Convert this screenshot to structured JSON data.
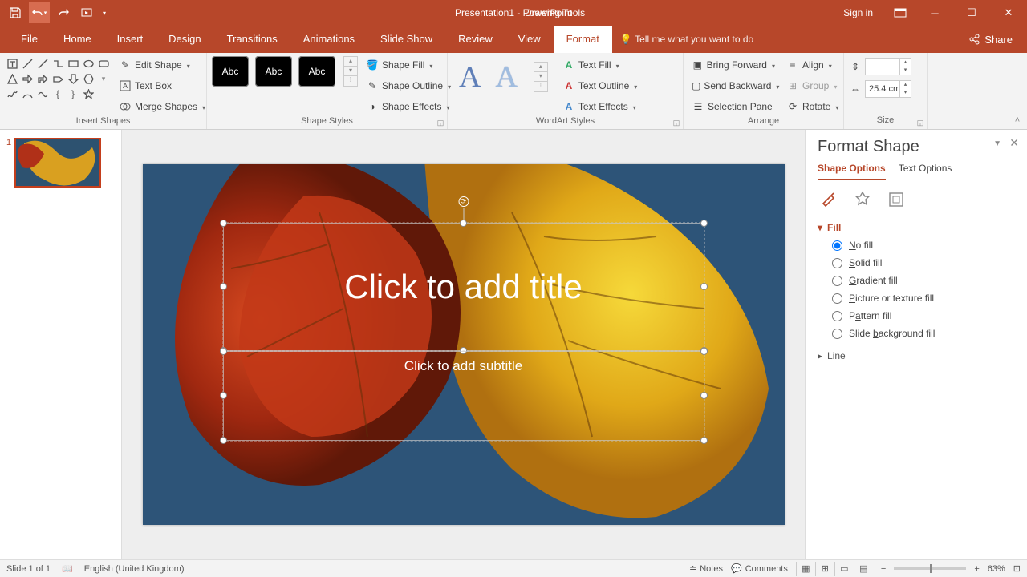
{
  "title_bar": {
    "title": "Presentation1 - PowerPoint",
    "context_tab": "Drawing Tools",
    "sign_in": "Sign in"
  },
  "tabs": {
    "file": "File",
    "home": "Home",
    "insert": "Insert",
    "design": "Design",
    "transitions": "Transitions",
    "animations": "Animations",
    "slideshow": "Slide Show",
    "review": "Review",
    "view": "View",
    "format": "Format",
    "tellme": "Tell me what you want to do",
    "share": "Share"
  },
  "ribbon": {
    "insert_shapes": {
      "label": "Insert Shapes",
      "edit_shape": "Edit Shape",
      "text_box": "Text Box",
      "merge_shapes": "Merge Shapes"
    },
    "shape_styles": {
      "label": "Shape Styles",
      "abc": "Abc",
      "shape_fill": "Shape Fill",
      "shape_outline": "Shape Outline",
      "shape_effects": "Shape Effects"
    },
    "wordart_styles": {
      "label": "WordArt Styles",
      "text_fill": "Text Fill",
      "text_outline": "Text Outline",
      "text_effects": "Text Effects"
    },
    "arrange": {
      "label": "Arrange",
      "bring_forward": "Bring Forward",
      "send_backward": "Send Backward",
      "selection_pane": "Selection Pane",
      "align": "Align",
      "group": "Group",
      "rotate": "Rotate"
    },
    "size": {
      "label": "Size",
      "height": "",
      "width": "25.4 cm"
    }
  },
  "thumb": {
    "num": "1"
  },
  "slide": {
    "title_placeholder": "Click to add title",
    "subtitle_placeholder": "Click to add subtitle"
  },
  "format_pane": {
    "title": "Format Shape",
    "tab_shape": "Shape Options",
    "tab_text": "Text Options",
    "fill": {
      "header": "Fill",
      "no_fill": "No fill",
      "solid": "Solid fill",
      "gradient": "Gradient fill",
      "picture": "Picture or texture fill",
      "pattern": "Pattern fill",
      "slidebg": "Slide background fill"
    },
    "line": {
      "header": "Line"
    }
  },
  "statusbar": {
    "slide_of": "Slide 1 of 1",
    "lang": "English (United Kingdom)",
    "notes": "Notes",
    "comments": "Comments",
    "zoom": "63%"
  }
}
